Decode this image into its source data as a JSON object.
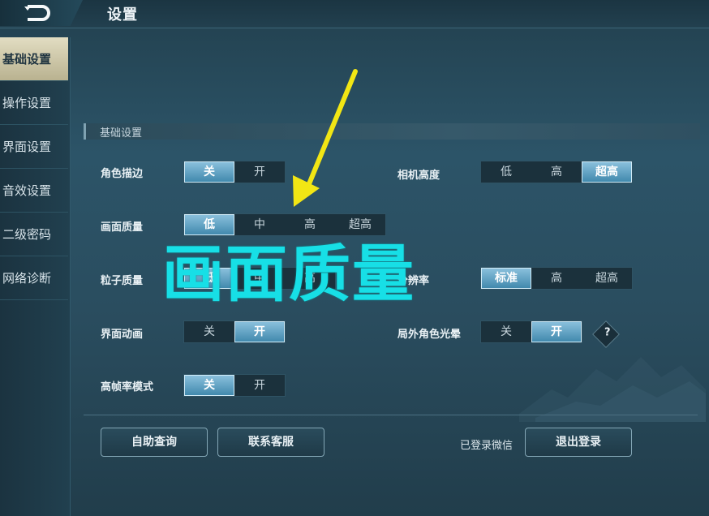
{
  "header": {
    "back_icon": "back-arrow-icon",
    "title": "设置"
  },
  "sidebar": {
    "items": [
      {
        "label": "基础设置",
        "active": true
      },
      {
        "label": "操作设置",
        "active": false
      },
      {
        "label": "界面设置",
        "active": false
      },
      {
        "label": "音效设置",
        "active": false
      },
      {
        "label": "二级密码",
        "active": false
      },
      {
        "label": "网络诊断",
        "active": false
      }
    ]
  },
  "section": {
    "title": "基础设置"
  },
  "settings": {
    "outline": {
      "label": "角色描边",
      "options": [
        "关",
        "开"
      ],
      "selected": "关"
    },
    "camera_height": {
      "label": "相机高度",
      "options": [
        "低",
        "高",
        "超高"
      ],
      "selected": "超高"
    },
    "graphics_quality": {
      "label": "画面质量",
      "options": [
        "低",
        "中",
        "高",
        "超高"
      ],
      "selected": "低"
    },
    "particle_quality": {
      "label": "粒子质量",
      "options": [
        "低",
        "中",
        "高"
      ],
      "selected": "低"
    },
    "resolution": {
      "label": "分辨率",
      "options": [
        "标准",
        "高",
        "超高"
      ],
      "selected": "标准"
    },
    "ui_animation": {
      "label": "界面动画",
      "options": [
        "关",
        "开"
      ],
      "selected": "开"
    },
    "outer_halo": {
      "label": "局外角色光晕",
      "options": [
        "关",
        "开"
      ],
      "selected": "开",
      "help": "?"
    },
    "high_fps": {
      "label": "高帧率模式",
      "options": [
        "关",
        "开"
      ],
      "selected": "关"
    }
  },
  "footer": {
    "self_service": "自助查询",
    "contact_support": "联系客服",
    "wechat_label": "已登录微信",
    "logout": "退出登录"
  },
  "overlay_caption": "画面质量",
  "colors": {
    "accent": "#5fa8cc",
    "overlay_text": "#17dfe6",
    "arrow": "#f2e614",
    "active_tab": "#d6d0b0"
  }
}
